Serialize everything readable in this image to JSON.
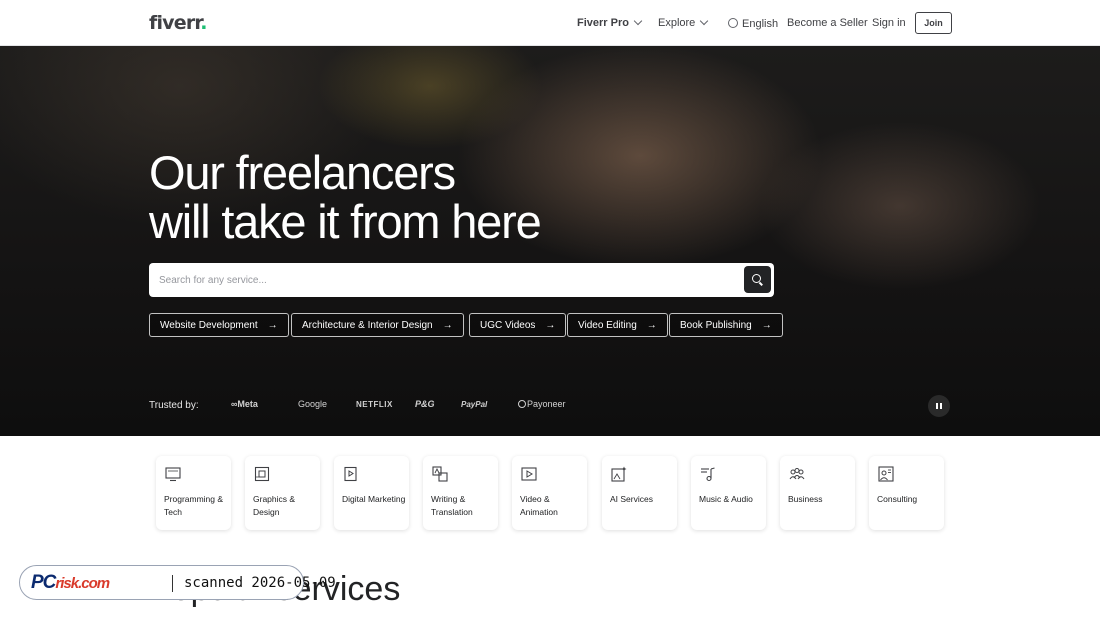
{
  "header": {
    "logo": "fiverr",
    "logo_dot": ".",
    "nav": {
      "pro": "Fiverr Pro",
      "explore": "Explore",
      "language": "English",
      "become_seller": "Become a Seller",
      "sign_in": "Sign in",
      "join": "Join"
    }
  },
  "hero": {
    "title_line1": "Our freelancers",
    "title_line2": "will take it from here",
    "search_placeholder": "Search for any service...",
    "chips": [
      {
        "label": "Website Development",
        "arrow": "→"
      },
      {
        "label": "Architecture & Interior Design",
        "arrow": "→"
      },
      {
        "label": "UGC Videos",
        "arrow": "→"
      },
      {
        "label": "Video Editing",
        "arrow": "→"
      },
      {
        "label": "Book Publishing",
        "arrow": "→"
      }
    ],
    "trusted_by": "Trusted by:",
    "brands": [
      "Meta",
      "Google",
      "NETFLIX",
      "P&G",
      "PayPal",
      "Payoneer"
    ],
    "meta_glyph": "∞"
  },
  "categories": [
    {
      "label": "Programming & Tech",
      "icon": "monitor-icon"
    },
    {
      "label": "Graphics & Design",
      "icon": "design-icon"
    },
    {
      "label": "Digital Marketing",
      "icon": "marketing-icon"
    },
    {
      "label": "Writing & Translation",
      "icon": "translation-icon"
    },
    {
      "label": "Video & Animation",
      "icon": "video-icon"
    },
    {
      "label": "AI Services",
      "icon": "ai-icon"
    },
    {
      "label": "Music & Audio",
      "icon": "music-icon"
    },
    {
      "label": "Business",
      "icon": "business-icon"
    },
    {
      "label": "Consulting",
      "icon": "consulting-icon"
    }
  ],
  "popular_title": "Popular services",
  "watermark": {
    "logo_pc": "PC",
    "logo_risk": "risk.com",
    "text": "scanned 2026-05-09"
  },
  "colors": {
    "brand_green": "#1dbf73",
    "text_dark": "#222325"
  }
}
